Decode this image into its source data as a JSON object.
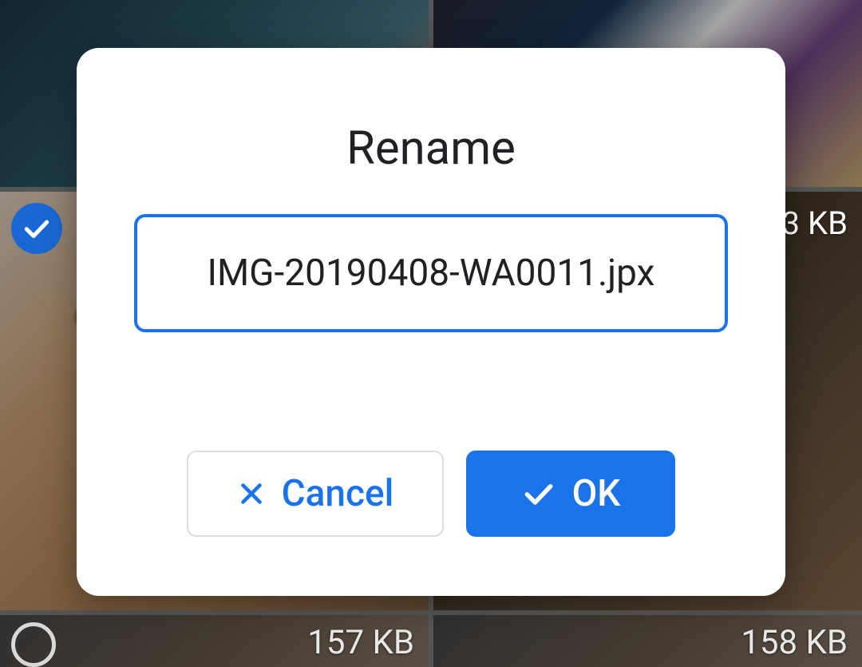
{
  "dialog": {
    "title": "Rename",
    "filename": "IMG-20190408-WA0011.jpx",
    "cancel_label": "Cancel",
    "ok_label": "OK"
  },
  "grid": {
    "tr_size": "3 KB",
    "bl_size": "157 KB",
    "br_size": "158 KB"
  },
  "colors": {
    "accent": "#1a73e8",
    "badge": "#1967d2"
  }
}
